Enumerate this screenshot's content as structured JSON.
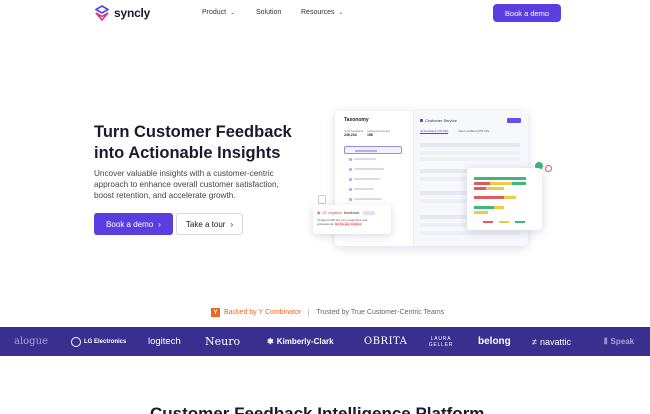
{
  "nav": {
    "brand": "syncly",
    "links": [
      {
        "label": "Product",
        "has_dropdown": true
      },
      {
        "label": "Solution",
        "has_dropdown": false
      },
      {
        "label": "Resources",
        "has_dropdown": true
      }
    ],
    "cta": "Book a demo"
  },
  "hero": {
    "title_line1": "Turn Customer Feedback",
    "title_line2": "into Actionable Insights",
    "subtitle": "Uncover valuable insights with a customer-centric approach to enhance overall customer satisfaction, boost retention, and accelerate growth.",
    "primary_button": "Book a demo",
    "secondary_button": "Take a tour"
  },
  "mockup": {
    "taxonomy_title": "Taxonomy",
    "stat1_label": "Total feedback",
    "stat1_value": "245,234",
    "stat2_label": "Categories found",
    "stat2_value": "156",
    "panel_title": "Customer Service",
    "tab1": "All feedback (45,430)",
    "tab2": "Has Low/Red (275.3%)",
    "fb_count": "32 negative",
    "fb_word": "feedback",
    "fb_quote_start": "\"Support staff are very supportive and professional, ",
    "fb_quote_highlight": "but the app crashes",
    "fb_quote_end": "\""
  },
  "backed": {
    "yc_glyph": "Y",
    "backed_label": "Backed by Y Combinator",
    "trusted_label": "Trusted by True Customer-Centric Teams"
  },
  "logos": [
    "alogue",
    "LG Electronics",
    "logitech",
    "Neuro",
    "Kimberly-Clark",
    "OBRITA",
    "LAURA GELLER",
    "belong",
    "navattic",
    "Speak"
  ],
  "section": {
    "title": "Customer Feedback Intelligence Platform"
  },
  "colors": {
    "accent": "#5b3ee0",
    "strip": "#3a2e8f",
    "yc": "#f26522"
  }
}
